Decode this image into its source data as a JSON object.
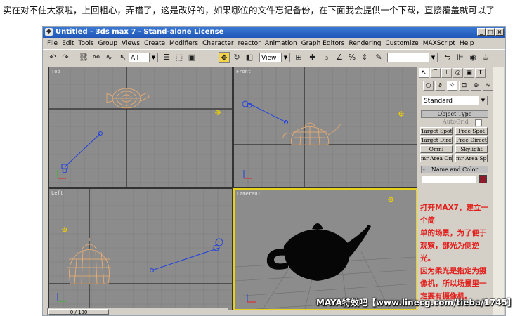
{
  "caption": "实在对不住大家啦，上回粗心，弄错了，这是改好的，如果哪位的文件忘记备份，在下面我会提供一个下载，直接覆盖就可以了",
  "window": {
    "title": "Untitled - 3ds max 7 - Stand-alone License",
    "app_icon": "max-app-icon",
    "buttons": [
      "_",
      "□",
      "×"
    ]
  },
  "menu": [
    "File",
    "Edit",
    "Tools",
    "Group",
    "Views",
    "Create",
    "Modifiers",
    "Character",
    "reactor",
    "Animation",
    "Graph Editors",
    "Rendering",
    "Customize",
    "MAXScript",
    "Help"
  ],
  "toolbar": {
    "selection_filter": "All",
    "reference_coord": "View",
    "named_selection": ""
  },
  "viewports": {
    "top": "Top",
    "front": "Front",
    "left": "Left",
    "camera": "Camera01"
  },
  "command_panel": {
    "create_type": "Standard",
    "object_type_title": "Object Type",
    "autogrid": "AutoGrid",
    "buttons": [
      "Target Spot",
      "Free Spot",
      "Target Direct",
      "Free Direct",
      "Omni",
      "Skylight",
      "mr Area Omni",
      "mr Area Spot"
    ],
    "name_color_title": "Name and Color",
    "color": "#8b1a2a"
  },
  "note_lines": [
    "打开MAX7，建立一个简",
    "单的场景，为了便于",
    "观察，部光为侧逆光。",
    "因为柔光是指定为摄",
    "像机，所以场景里一",
    "定要有摄像机。"
  ],
  "timeline": "0 / 100",
  "watermark": "MAYA特效吧【www.linecg.com/tieba/1745】",
  "colors": {
    "title_blue": "#2a62c8",
    "viewport_bg": "#8c8c8c",
    "active_border": "#e6d21c",
    "wire": "#f0b070",
    "note_red": "#e2201c"
  }
}
